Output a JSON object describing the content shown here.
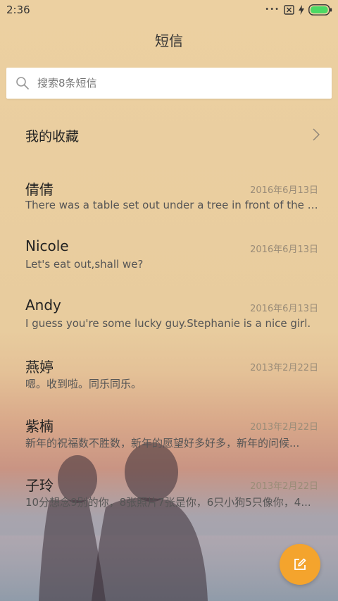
{
  "status_bar": {
    "time": "2:36",
    "battery_color": "#4cd964"
  },
  "header": {
    "title": "短信"
  },
  "search": {
    "placeholder": "搜索8条短信",
    "icon": "search-icon"
  },
  "favorites": {
    "label": "我的收藏",
    "icon": "chevron-right-icon"
  },
  "threads": [
    {
      "name": "倩倩",
      "date": "2016年6月13日",
      "preview": "There was a table set out under a tree in front of the house..."
    },
    {
      "name": "Nicole",
      "date": "2016年6月13日",
      "preview": "Let's eat out,shall we?"
    },
    {
      "name": "Andy",
      "date": "2016年6月13日",
      "preview": "I guess you're some lucky guy.Stephanie is a nice girl."
    },
    {
      "name": "燕婷",
      "date": "2013年2月22日",
      "preview": "嗯。收到啦。同乐同乐。"
    },
    {
      "name": "紫楠",
      "date": "2013年2月22日",
      "preview": "新年的祝福数不胜数，新年的愿望好多好多，新年的问候..."
    },
    {
      "name": "子玲",
      "date": "2013年2月22日",
      "preview": "10分想念9别的你，8张照片7张是你，6只小狗5只像你，4..."
    }
  ],
  "fab": {
    "icon": "compose-icon",
    "color": "#f4a42d"
  }
}
